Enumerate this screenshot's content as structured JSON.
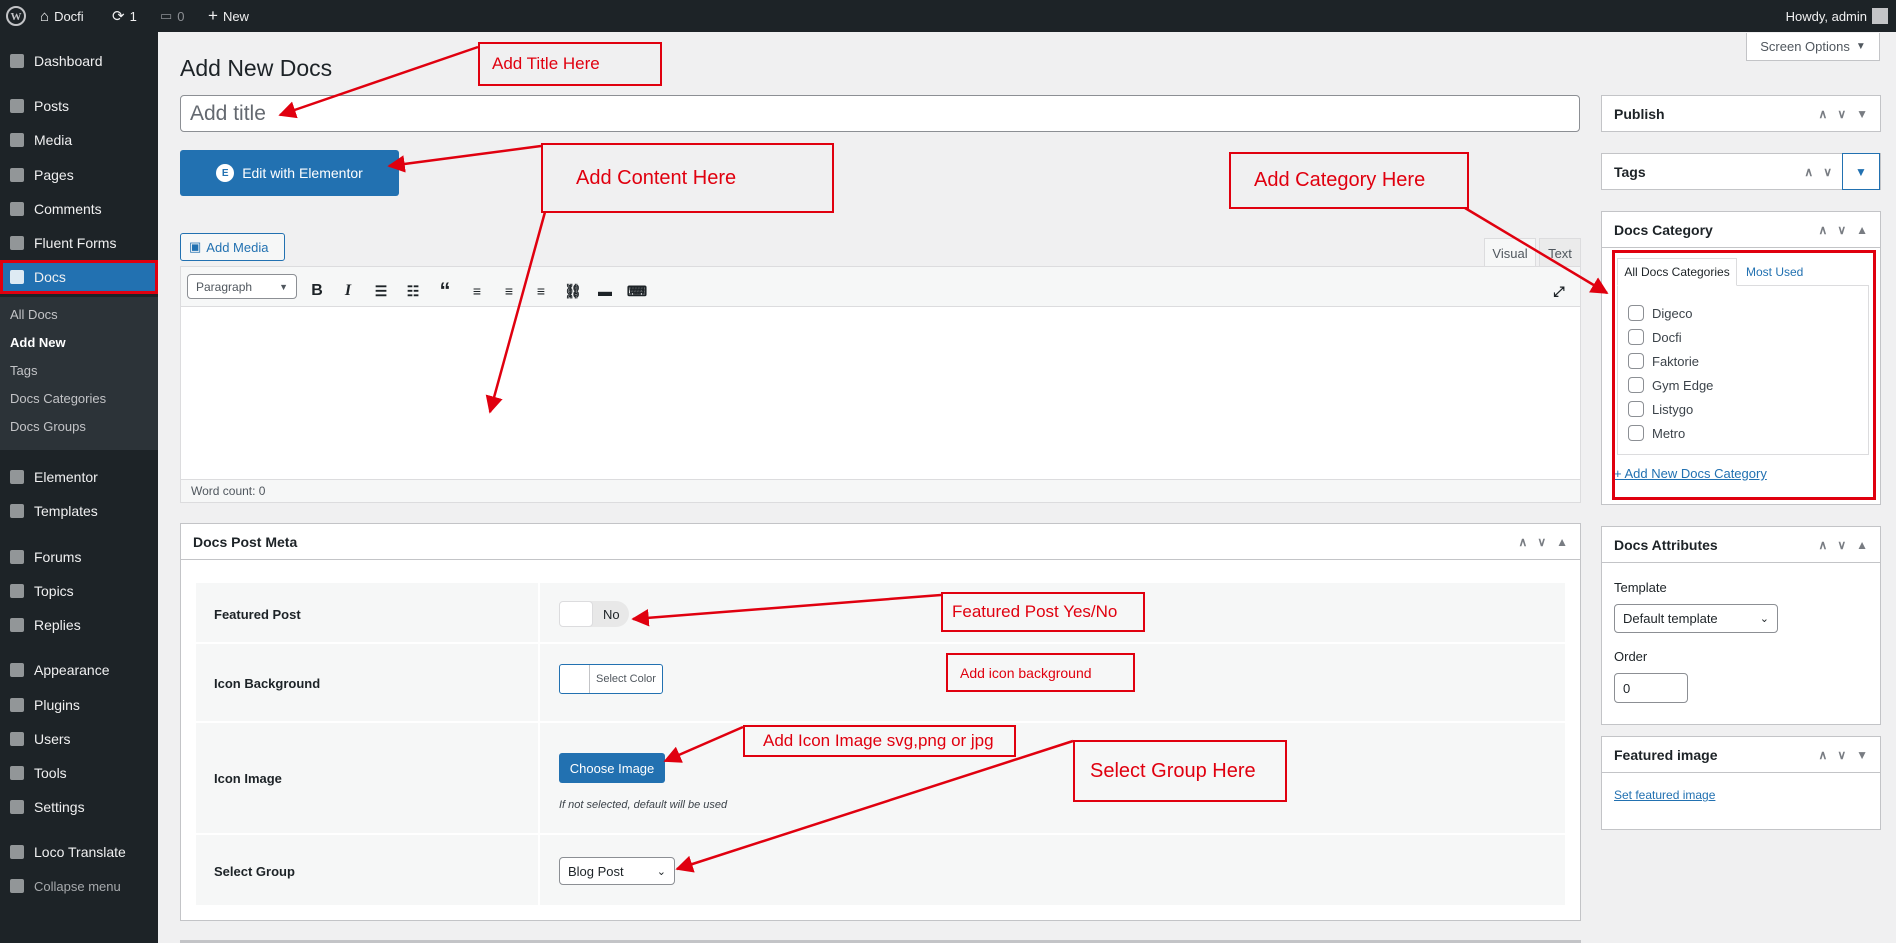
{
  "adminbar": {
    "site": "Docfi",
    "updates": "1",
    "comments": "0",
    "new": "New",
    "howdy": "Howdy, admin"
  },
  "sidebar": {
    "items": [
      {
        "label": "Dashboard",
        "icon": "dashboard-icon"
      },
      {
        "label": "Posts",
        "icon": "pin-icon"
      },
      {
        "label": "Media",
        "icon": "media-icon"
      },
      {
        "label": "Pages",
        "icon": "pages-icon"
      },
      {
        "label": "Comments",
        "icon": "comments-icon"
      },
      {
        "label": "Fluent Forms",
        "icon": "forms-icon"
      },
      {
        "label": "Docs",
        "icon": "docs-icon"
      },
      {
        "label": "Elementor",
        "icon": "elementor-icon"
      },
      {
        "label": "Templates",
        "icon": "folder-icon"
      },
      {
        "label": "Forums",
        "icon": "forums-icon"
      },
      {
        "label": "Topics",
        "icon": "topics-icon"
      },
      {
        "label": "Replies",
        "icon": "replies-icon"
      },
      {
        "label": "Appearance",
        "icon": "brush-icon"
      },
      {
        "label": "Plugins",
        "icon": "plugin-icon"
      },
      {
        "label": "Users",
        "icon": "user-icon"
      },
      {
        "label": "Tools",
        "icon": "wrench-icon"
      },
      {
        "label": "Settings",
        "icon": "settings-icon"
      },
      {
        "label": "Loco Translate",
        "icon": "translate-icon"
      },
      {
        "label": "Collapse menu",
        "icon": "collapse-icon"
      }
    ],
    "submenu": [
      "All Docs",
      "Add New",
      "Tags",
      "Docs Categories",
      "Docs Groups"
    ]
  },
  "page": {
    "title": "Add New Docs",
    "screen_options": "Screen Options",
    "title_placeholder": "Add title",
    "elementor_btn": "Edit with Elementor",
    "add_media": "Add Media"
  },
  "editor": {
    "tab_visual": "Visual",
    "tab_text": "Text",
    "format": "Paragraph",
    "word_count": "Word count: 0"
  },
  "meta": {
    "title": "Docs Post Meta",
    "featured_label": "Featured Post",
    "featured_value": "No",
    "iconbg_label": "Icon Background",
    "iconbg_btn": "Select Color",
    "iconimg_label": "Icon Image",
    "iconimg_btn": "Choose Image",
    "iconimg_note": "If not selected, default will be used",
    "group_label": "Select Group",
    "group_value": "Blog Post"
  },
  "side": {
    "publish": "Publish",
    "tags": "Tags",
    "docs_category": "Docs Category",
    "cat_tab_all": "All Docs Categories",
    "cat_tab_used": "Most Used",
    "categories": [
      "Digeco",
      "Docfi",
      "Faktorie",
      "Gym Edge",
      "Listygo",
      "Metro"
    ],
    "add_category": "+ Add New Docs Category",
    "attributes": "Docs Attributes",
    "template_label": "Template",
    "template_value": "Default template",
    "order_label": "Order",
    "order_value": "0",
    "featured_image": "Featured image",
    "set_featured": "Set featured image"
  },
  "annotations": {
    "title": "Add Title Here",
    "content": "Add  Content Here",
    "category": "Add Category Here",
    "featured": "Featured Post Yes/No",
    "iconbg": "Add icon background",
    "iconimg": "Add Icon Image svg,png or jpg",
    "group": "Select Group Here"
  },
  "colors": {
    "accent": "#2271b1",
    "annotation": "#e0000f",
    "sidebar": "#1d2327"
  }
}
